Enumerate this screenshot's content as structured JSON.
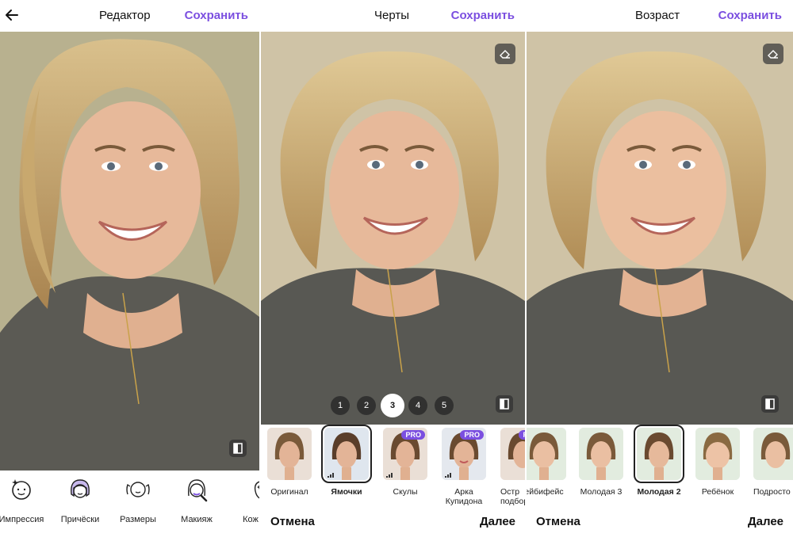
{
  "panel1": {
    "title": "Редактор",
    "save": "Сохранить",
    "tools": [
      {
        "label": "Импрессия",
        "icon": "face-sparkle-icon"
      },
      {
        "label": "Причёски",
        "icon": "hairstyle-icon"
      },
      {
        "label": "Размеры",
        "icon": "face-resize-icon"
      },
      {
        "label": "Макияж",
        "icon": "makeup-icon"
      },
      {
        "label": "Кож",
        "icon": "skin-icon"
      }
    ]
  },
  "panel2": {
    "title": "Черты",
    "save": "Сохранить",
    "levels": [
      "1",
      "2",
      "3",
      "4",
      "5"
    ],
    "active_level": "3",
    "thumbs": [
      {
        "label": "Оригинал",
        "pro": false
      },
      {
        "label": "Ямочки",
        "pro": false,
        "selected": true
      },
      {
        "label": "Скулы",
        "pro": true
      },
      {
        "label": "Арка Купидона",
        "pro": true
      },
      {
        "label": "Остр подбор",
        "pro": true
      }
    ],
    "pro_label": "PRO",
    "cancel": "Отмена",
    "next": "Далее"
  },
  "panel3": {
    "title": "Возраст",
    "save": "Сохранить",
    "thumbs": [
      {
        "label": "ейбифейс"
      },
      {
        "label": "Молодая 3"
      },
      {
        "label": "Молодая 2",
        "selected": true
      },
      {
        "label": "Ребёнок"
      },
      {
        "label": "Подросто"
      }
    ],
    "cancel": "Отмена",
    "next": "Далее"
  },
  "colors": {
    "accent": "#7b4fe0",
    "pro_badge": "#7b4fe0"
  }
}
